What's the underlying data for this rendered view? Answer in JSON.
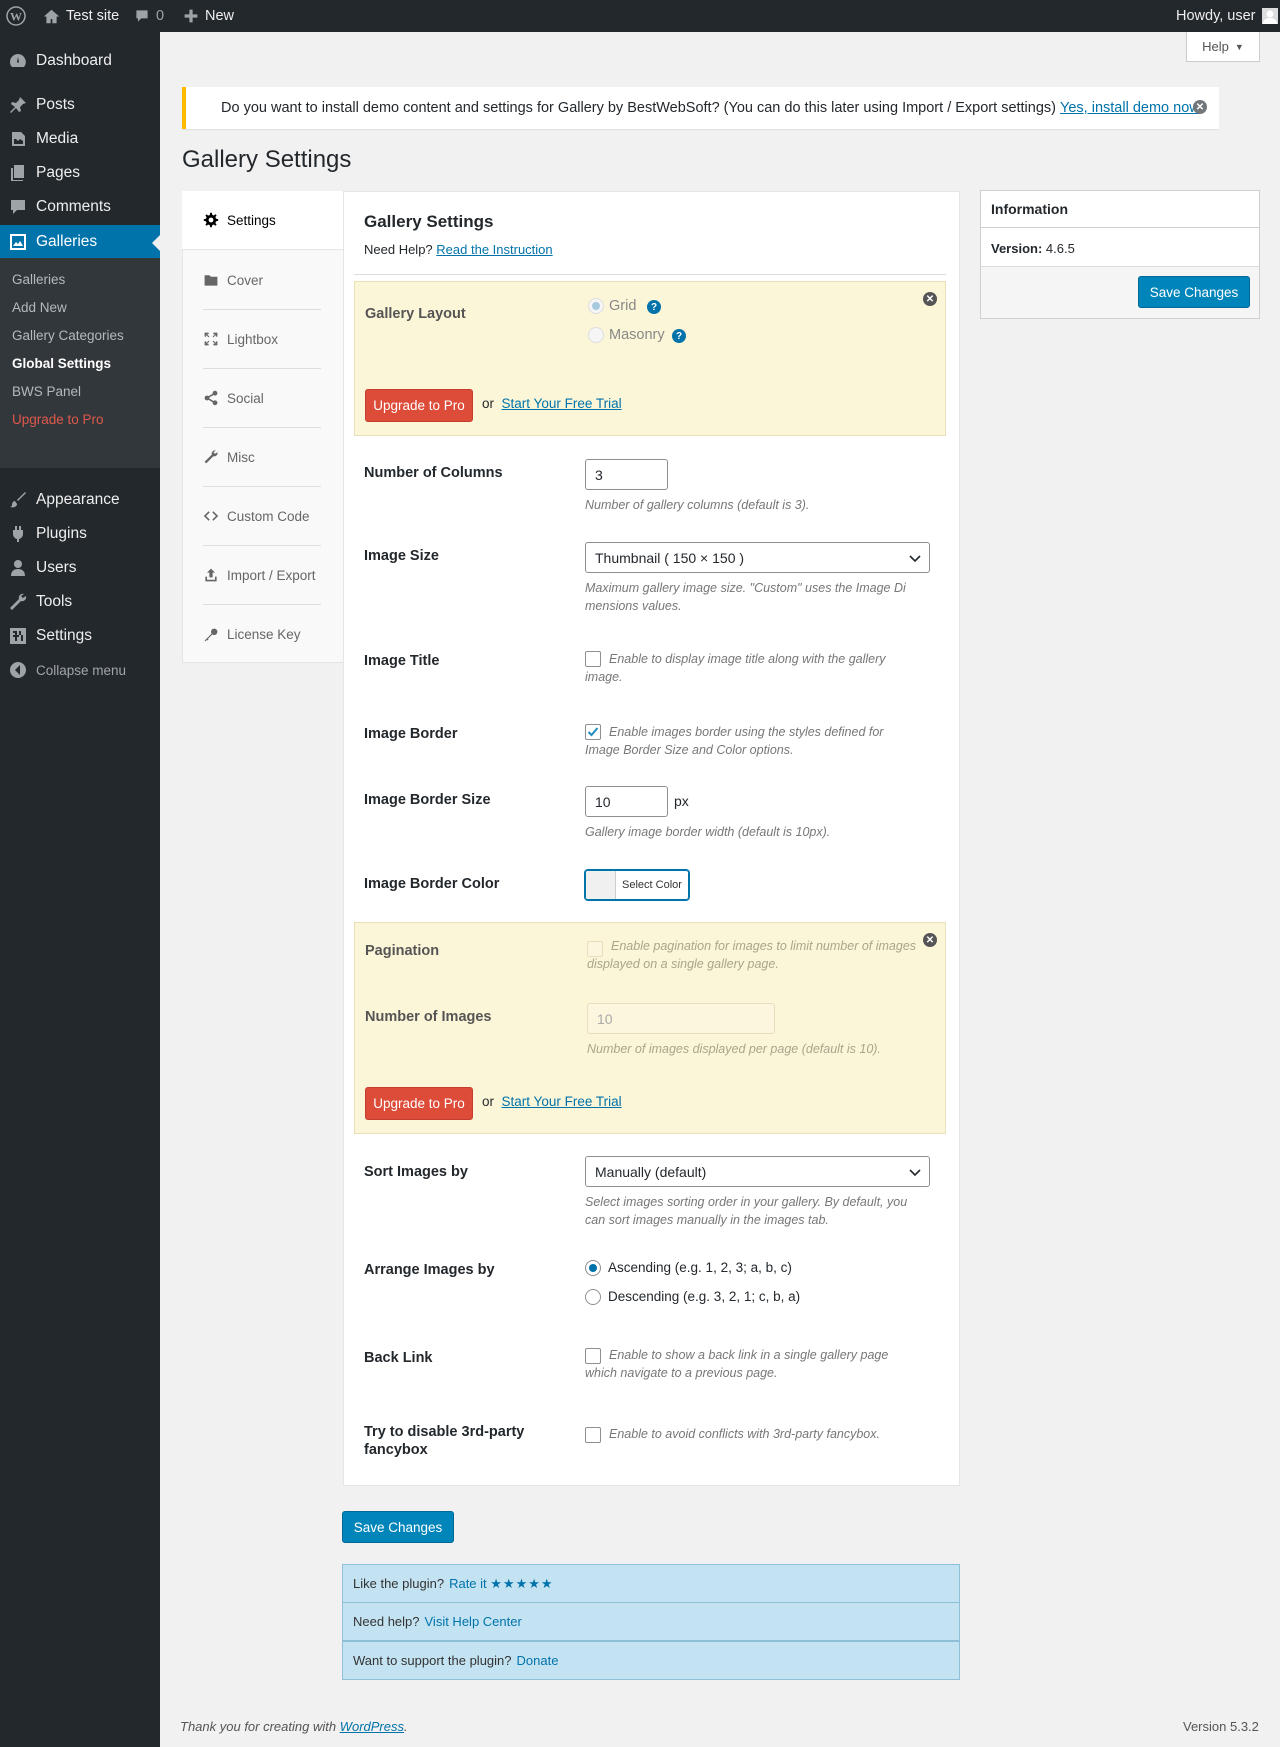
{
  "admin_bar": {
    "site_name": "Test site",
    "comments_count": "0",
    "new_label": "New",
    "howdy": "Howdy, user"
  },
  "sidebar": {
    "items": [
      {
        "label": "Dashboard",
        "icon": "dashboard-icon"
      },
      {
        "label": "Posts",
        "icon": "pin-icon"
      },
      {
        "label": "Media",
        "icon": "media-icon"
      },
      {
        "label": "Pages",
        "icon": "pages-icon"
      },
      {
        "label": "Comments",
        "icon": "comment-icon"
      },
      {
        "label": "Galleries",
        "icon": "gallery-icon"
      },
      {
        "label": "Appearance",
        "icon": "brush-icon"
      },
      {
        "label": "Plugins",
        "icon": "plug-icon"
      },
      {
        "label": "Users",
        "icon": "user-icon"
      },
      {
        "label": "Tools",
        "icon": "wrench-icon"
      },
      {
        "label": "Settings",
        "icon": "settings-icon"
      },
      {
        "label": "Collapse menu",
        "icon": "collapse-icon"
      }
    ],
    "submenu": [
      "Galleries",
      "Add New",
      "Gallery Categories",
      "Global Settings",
      "BWS Panel",
      "Upgrade to Pro"
    ]
  },
  "help_tab": "Help",
  "notice": {
    "text": "Do you want to install demo content and settings for Gallery by BestWebSoft? (You can do this later using Import / Export settings)",
    "link": "Yes, install demo now"
  },
  "page_title": "Gallery Settings",
  "tabs": [
    "Settings",
    "Cover",
    "Lightbox",
    "Social",
    "Misc",
    "Custom Code",
    "Import / Export",
    "License Key"
  ],
  "main": {
    "heading": "Gallery Settings",
    "need_help": "Need Help?",
    "read_instruction": "Read the Instruction",
    "gallery_layout": {
      "label": "Gallery Layout",
      "options": [
        "Grid",
        "Masonry"
      ],
      "selected": "Grid"
    },
    "upgrade_label": "Upgrade to Pro",
    "or_text": "or",
    "trial_label": "Start Your Free Trial",
    "columns": {
      "label": "Number of Columns",
      "value": "3",
      "desc": "Number of gallery columns (default is 3)."
    },
    "image_size": {
      "label": "Image Size",
      "value": "Thumbnail ( 150 × 150 )",
      "desc_line1": "Maximum gallery image size. \"Custom\" uses the Image Di",
      "desc_line2": "mensions values."
    },
    "image_title": {
      "label": "Image Title",
      "desc_line1": "Enable to display image title along with the gallery",
      "desc_line2": "image.",
      "checked": false
    },
    "image_border": {
      "label": "Image Border",
      "desc_line1": "Enable images border using the styles defined for",
      "desc_line2": "Image Border Size and Color options.",
      "checked": true
    },
    "border_size": {
      "label": "Image Border Size",
      "value": "10",
      "unit": "px",
      "desc": "Gallery image border width (default is 10px)."
    },
    "border_color": {
      "label": "Image Border Color",
      "button": "Select Color"
    },
    "pagination": {
      "label": "Pagination",
      "desc_line1": "Enable pagination for images to limit number of images",
      "desc_line2": "displayed on a single gallery page."
    },
    "num_images": {
      "label": "Number of Images",
      "value": "10",
      "desc": "Number of images displayed per page (default is 10)."
    },
    "sort": {
      "label": "Sort Images by",
      "value": "Manually (default)",
      "desc_line1": "Select images sorting order in your gallery. By default, you",
      "desc_line2": "can sort images manually in the images tab."
    },
    "arrange": {
      "label": "Arrange Images by",
      "options": [
        "Ascending (e.g. 1, 2, 3; a, b, c)",
        "Descending (e.g. 3, 2, 1; c, b, a)"
      ],
      "selected": "Ascending (e.g. 1, 2, 3; a, b, c)"
    },
    "back_link": {
      "label": "Back Link",
      "desc_line1": "Enable to show a back link in a single gallery page",
      "desc_line2": "which navigate to a previous page.",
      "checked": false
    },
    "fancybox": {
      "label_line1": "Try to disable 3rd-party",
      "label_line2": "fancybox",
      "desc": "Enable to avoid conflicts with 3rd-party fancybox.",
      "checked": false
    }
  },
  "save_label": "Save Changes",
  "info": {
    "title": "Information",
    "version_label": "Version:",
    "version_value": "4.6.5"
  },
  "rate_rows": [
    {
      "text": "Like the plugin?",
      "link": "Rate it",
      "stars": "★★★★★"
    },
    {
      "text": "Need help?",
      "link": "Visit Help Center"
    },
    {
      "text": "Want to support the plugin?",
      "link": "Donate"
    }
  ],
  "footer": {
    "thanks": "Thank you for creating with",
    "wp_link": "WordPress",
    "period": ".",
    "version": "Version 5.3.2"
  },
  "colors": {
    "accent": "#0073aa",
    "upgrade": "#dd4b39",
    "pro_bg": "#fcf6d8",
    "admin_dark": "#23282d"
  }
}
